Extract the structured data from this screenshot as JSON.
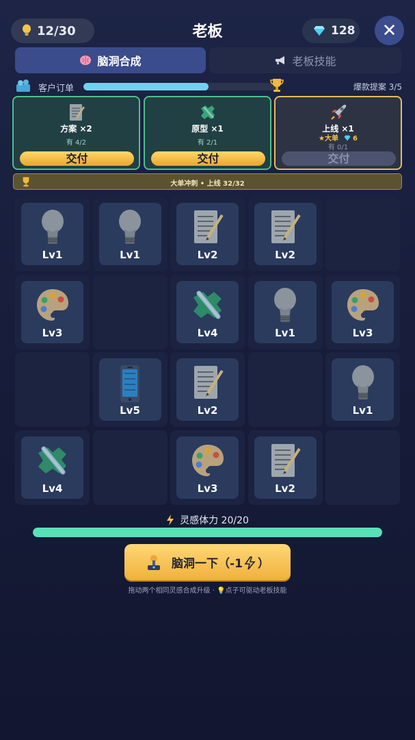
{
  "header": {
    "ideas": "12/30",
    "title": "老板",
    "gems": "128",
    "close_symbol": "✕",
    "icons": {
      "ideas": "lightbulb-icon",
      "gems": "diamond-icon",
      "close": "close-icon"
    }
  },
  "tabs": [
    {
      "label": "脑洞合成",
      "icon": "brain-icon",
      "active": true
    },
    {
      "label": "老板技能",
      "icon": "megaphone-icon",
      "active": false
    }
  ],
  "orders": {
    "label": "客户订单",
    "progress": 0.65,
    "hot_label": "爆款提案 3/5",
    "accent": "#6ed3ef"
  },
  "order_cards": [
    {
      "name": "方案 ×2",
      "have": "有 4/2",
      "button": "交付",
      "icon": "document-icon",
      "ready": true
    },
    {
      "name": "原型 ×1",
      "have": "有 2/1",
      "button": "交付",
      "icon": "puzzle-icon",
      "ready": true
    },
    {
      "name": "上线 ×1",
      "big_tag": "★大单",
      "gem_reward": "6",
      "have": "有 0/1",
      "button": "交付",
      "icon": "rocket-icon",
      "ready": false
    }
  ],
  "rush_banner": "大单冲刺 • 上线  32/32",
  "grid": [
    [
      "bulb:Lv1",
      "bulb:Lv1",
      "doc:Lv2",
      "doc:Lv2",
      ""
    ],
    [
      "palette:Lv3",
      "",
      "puzzle:Lv4",
      "bulb:Lv1",
      "palette:Lv3"
    ],
    [
      "",
      "phone:Lv5",
      "doc:Lv2",
      "",
      "bulb:Lv1"
    ],
    [
      "puzzle:Lv4",
      "",
      "palette:Lv3",
      "doc:Lv2",
      ""
    ]
  ],
  "stamina": {
    "label": "灵感体力 20/20",
    "fraction": 1.0
  },
  "action_button": "脑洞一下（-1",
  "hint": "拖动两个相同灵感合成升级 · 💡点子可驱动老板技能",
  "colors": {
    "gold": "#f0b13c",
    "green": "#58e1b7",
    "tab_active": "#3a4c8c"
  }
}
